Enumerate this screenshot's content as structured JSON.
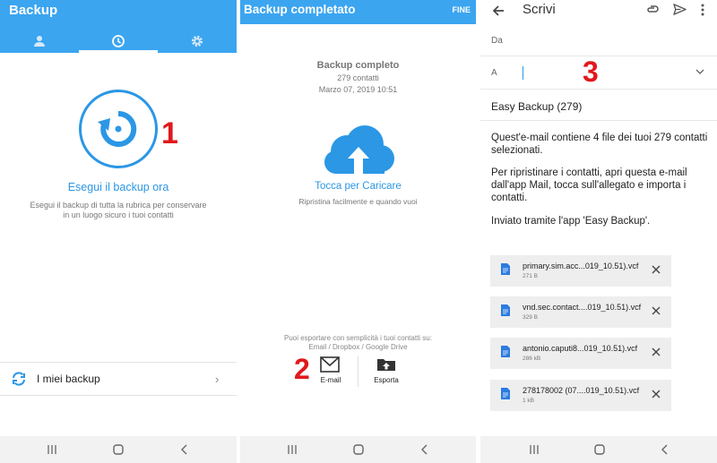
{
  "colors": {
    "accent": "#3ba5f0",
    "link": "#2b97e5",
    "step": "#e0191c"
  },
  "panel1": {
    "title": "Backup",
    "tabs": [
      "person-icon",
      "history-icon",
      "gear-icon"
    ],
    "step_number": "1",
    "action": "Esegui il backup ora",
    "description_line1": "Esegui il backup di tutta la rubrica per conservare",
    "description_line2": "in un luogo sicuro i tuoi contatti",
    "my_backups_label": "I miei backup"
  },
  "panel2": {
    "title": "Backup completato",
    "done_label": "FINE",
    "heading": "Backup completo",
    "contacts_count": "279 contatti",
    "date": "Marzo 07, 2019 10:51",
    "action": "Tocca per Caricare",
    "description": "Ripristina facilmente e quando vuoi",
    "export_line1": "Puoi esportare con semplicità i tuoi contatti su:",
    "export_line2": "Email / Dropbox / Google Drive",
    "step_number": "2",
    "email_label": "E-mail",
    "export_label": "Esporta"
  },
  "panel3": {
    "title": "Scrivi",
    "from_label": "Da",
    "to_label": "A",
    "step_number": "3",
    "subject": "Easy Backup (279)",
    "body_p1_l1": "Quest'e-mail contiene 4 file dei tuoi 279 contatti",
    "body_p1_l2": "selezionati.",
    "body_p2_l1": "Per ripristinare i contatti, apri questa e-mail",
    "body_p2_l2": "dall'app Mail, tocca sull'allegato e importa i",
    "body_p2_l3": "contatti.",
    "body_p3": "Inviato tramite l'app 'Easy Backup'.",
    "attachments": [
      {
        "name": "primary.sim.acc...019_10.51).vcf",
        "size": "271 B"
      },
      {
        "name": "vnd.sec.contact....019_10.51).vcf",
        "size": "329 B"
      },
      {
        "name": "antonio.caputi8...019_10.51).vcf",
        "size": "286 kB"
      },
      {
        "name": "278178002 (07....019_10.51).vcf",
        "size": "1 kB"
      }
    ]
  },
  "navbar": [
    "recent-apps-icon",
    "home-icon",
    "back-icon"
  ]
}
